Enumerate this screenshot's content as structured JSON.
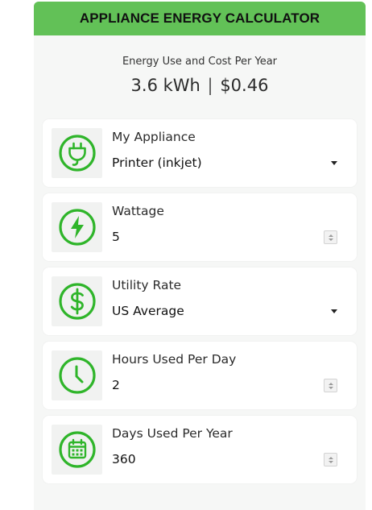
{
  "header": {
    "title": "APPLIANCE ENERGY CALCULATOR"
  },
  "summary": {
    "label": "Energy Use and Cost Per Year",
    "kwh": "3.6 kWh",
    "separator": "|",
    "cost": "$0.46"
  },
  "colors": {
    "accent": "#62c157",
    "icon_green": "#2fb52a",
    "panel_bg": "#f6f7f6"
  },
  "fields": {
    "appliance": {
      "label": "My Appliance",
      "value": "Printer (inkjet)",
      "icon": "plug-icon",
      "control": "select"
    },
    "wattage": {
      "label": "Wattage",
      "value": "5",
      "icon": "lightning-bolt-icon",
      "control": "number"
    },
    "utility_rate": {
      "label": "Utility Rate",
      "value": "US Average",
      "icon": "dollar-sign-icon",
      "control": "select"
    },
    "hours": {
      "label": "Hours Used Per Day",
      "value": "2",
      "icon": "clock-icon",
      "control": "number"
    },
    "days": {
      "label": "Days Used Per Year",
      "value": "360",
      "icon": "calendar-icon",
      "control": "number"
    }
  }
}
